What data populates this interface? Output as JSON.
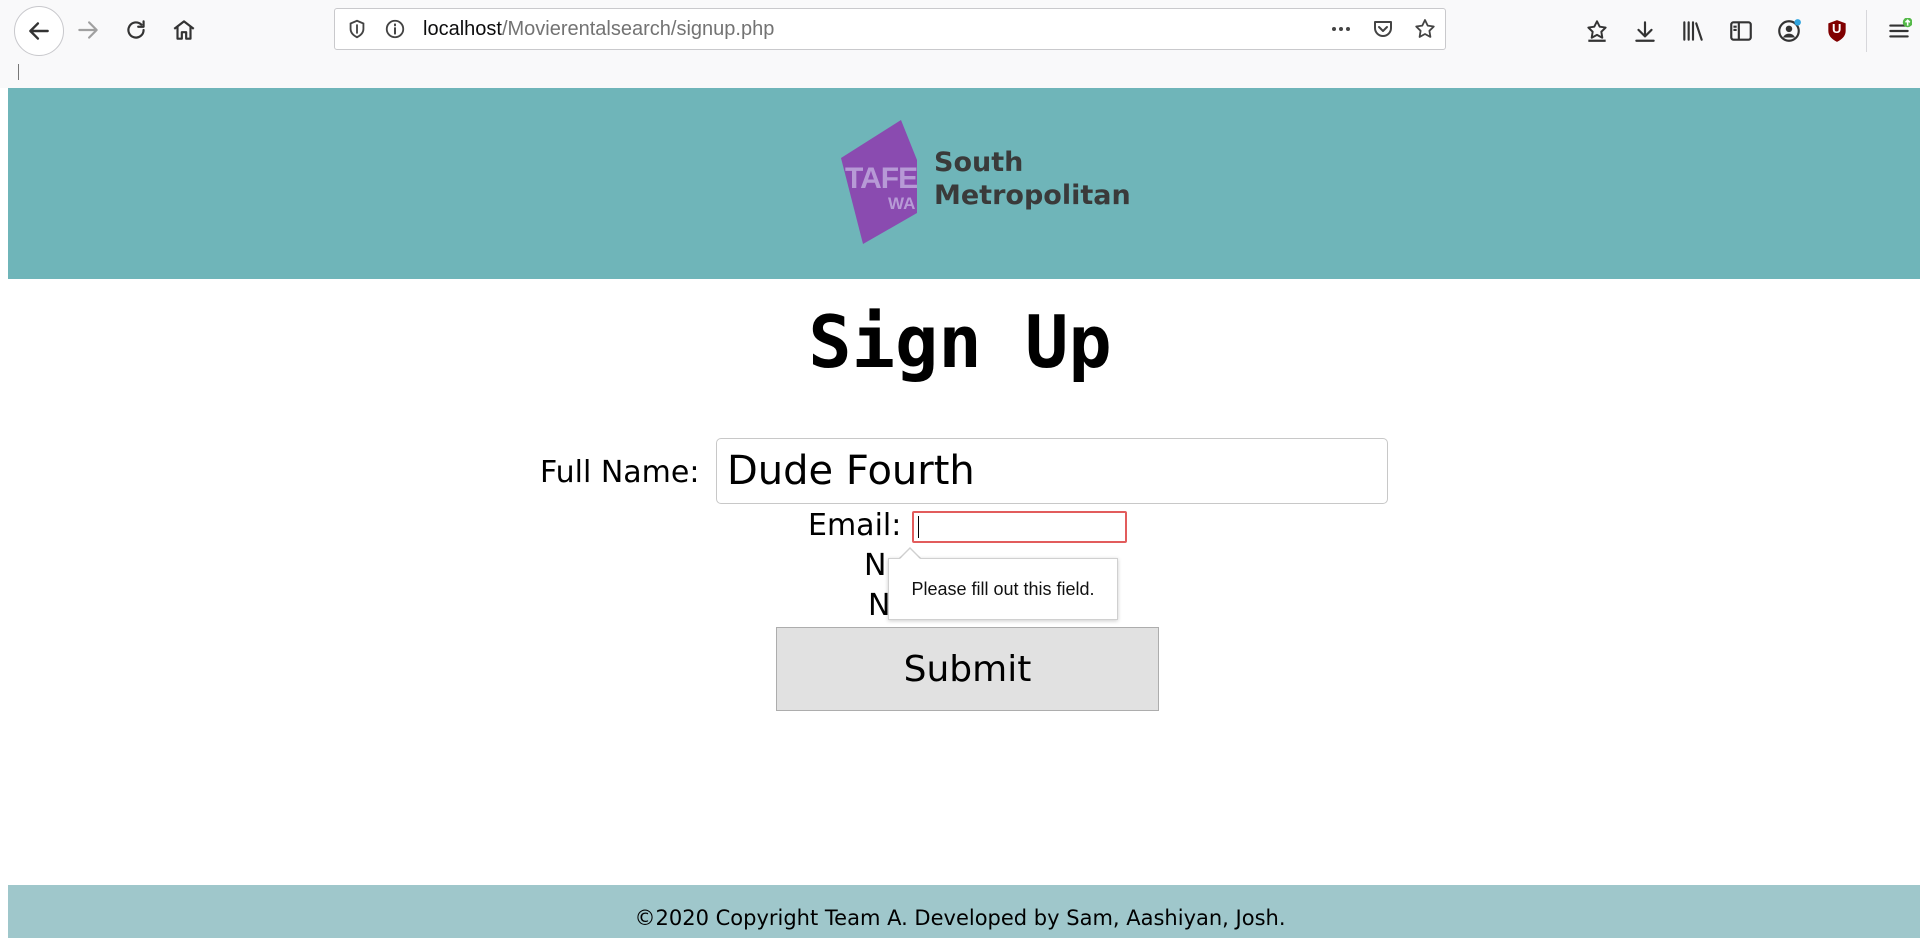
{
  "browser": {
    "url_host": "localhost",
    "url_path": "/Movierentalsearch/signup.php",
    "icons": [
      "back-icon",
      "forward-icon",
      "reload-icon",
      "home-icon",
      "shield-icon",
      "info-icon",
      "more-icon",
      "pocket-icon",
      "star-icon",
      "bookmarks-star-icon",
      "download-icon",
      "library-icon",
      "sidebar-icon",
      "account-icon",
      "ublock-icon",
      "menu-icon"
    ],
    "ublock_label": "U"
  },
  "header": {
    "logo_tafe": "TAFE",
    "logo_wa": "WA",
    "logo_line1": "South",
    "logo_line2": "Metropolitan",
    "background": "#6fb5b9"
  },
  "form": {
    "title": "Sign Up",
    "fullname_label": "Full Name:",
    "fullname_value": "Dude Fourth",
    "email_label": "Email:",
    "email_value": "",
    "row3_label_visible": "N",
    "row4_label_visible": "N",
    "validation_message": "Please fill out this field.",
    "submit_label": "Submit"
  },
  "footer": {
    "text": "©2020 Copyright Team A. Developed by Sam, Aashiyan, Josh.",
    "background": "#9fc7cb"
  }
}
